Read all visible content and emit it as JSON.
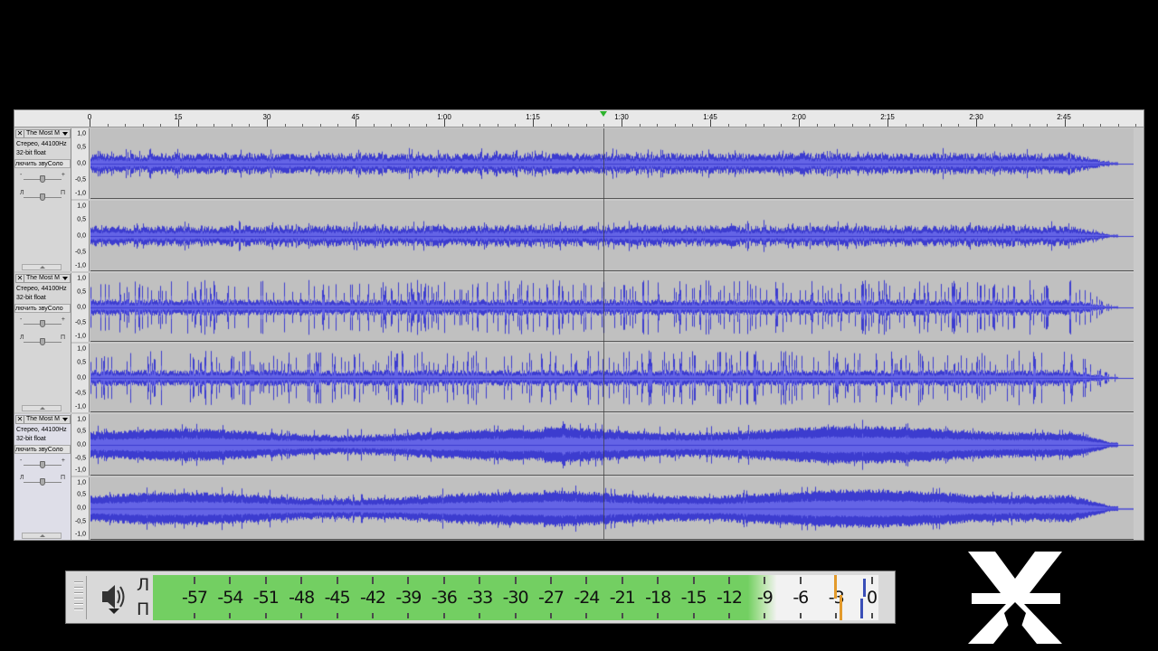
{
  "ruler": {
    "labels": [
      "0",
      "15",
      "30",
      "45",
      "1:00",
      "1:15",
      "1:30",
      "1:45",
      "2:00",
      "2:15",
      "2:30",
      "2:45"
    ]
  },
  "tracks": [
    {
      "name": "The Most M",
      "info_line1": "Стерео, 44100Hz",
      "info_line2": "32-bit float",
      "mute_solo": "лючить звуСоло",
      "pan_left": "Л",
      "pan_right": "П",
      "wave_style": "dense-low",
      "selected": false
    },
    {
      "name": "The Most M",
      "info_line1": "Стерео, 44100Hz",
      "info_line2": "32-bit float",
      "mute_solo": "лючить звуСоло",
      "pan_left": "Л",
      "pan_right": "П",
      "wave_style": "spiky",
      "selected": false
    },
    {
      "name": "The Most M",
      "info_line1": "Стерео, 44100Hz",
      "info_line2": "32-bit float",
      "mute_solo": "лючить звуСоло",
      "pan_left": "Л",
      "pan_right": "П",
      "wave_style": "dense-loud",
      "selected": true
    }
  ],
  "vruler_labels": [
    "1,0",
    "0,5",
    "0,0",
    "-0,5",
    "-1,0"
  ],
  "meter": {
    "left_channel": "Л",
    "right_channel": "П",
    "scale": [
      "-57",
      "-54",
      "-51",
      "-48",
      "-45",
      "-42",
      "-39",
      "-36",
      "-33",
      "-30",
      "-27",
      "-24",
      "-21",
      "-18",
      "-15",
      "-12",
      "-9",
      "-6",
      "-3",
      "0"
    ],
    "icon": "speaker-icon"
  },
  "colors": {
    "waveform": "#3c3ccf",
    "waveform_rms": "#6464e6",
    "meter_green": "#73cf62",
    "peak_orange": "#e39a2b",
    "peak_blue": "#3a4fb8",
    "playhead": "#2db32d"
  },
  "logo": {
    "icon": "brand-logo-icon"
  }
}
